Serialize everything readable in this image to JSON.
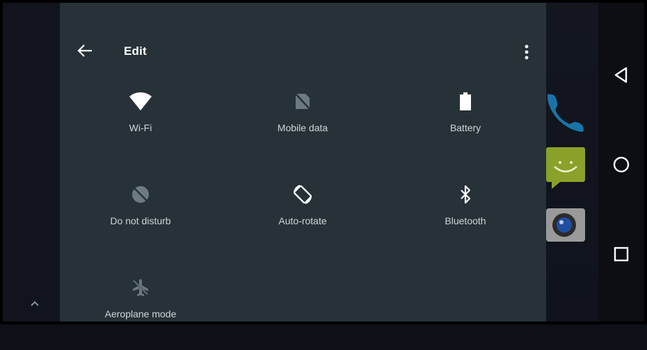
{
  "toolbar": {
    "title": "Edit"
  },
  "tiles": [
    {
      "label": "Wi-Fi",
      "icon": "wifi-icon"
    },
    {
      "label": "Mobile data",
      "icon": "mobile-data-off-icon"
    },
    {
      "label": "Battery",
      "icon": "battery-icon"
    },
    {
      "label": "Do not disturb",
      "icon": "do-not-disturb-icon"
    },
    {
      "label": "Auto-rotate",
      "icon": "auto-rotate-icon"
    },
    {
      "label": "Bluetooth",
      "icon": "bluetooth-icon"
    },
    {
      "label": "Aeroplane mode",
      "icon": "airplane-mode-off-icon"
    }
  ],
  "colors": {
    "panel": "#263238",
    "tile_active_icon": "#ffffff",
    "tile_inactive_icon": "#6d7a80",
    "label": "#d0d5d8"
  },
  "navbar": {
    "buttons": [
      "back-icon",
      "home-icon",
      "recents-icon"
    ]
  }
}
